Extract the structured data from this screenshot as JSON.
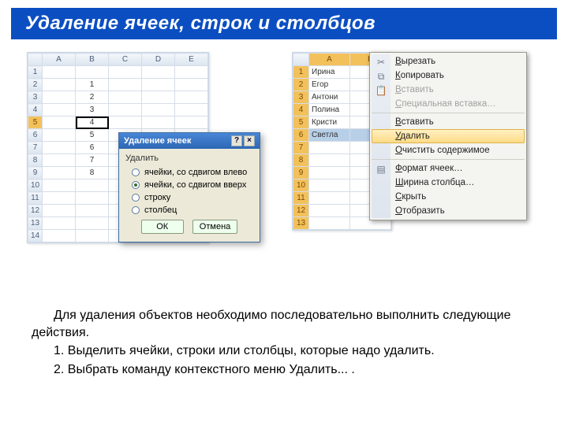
{
  "title": "Удаление ячеек, строк и столбцов",
  "grid1": {
    "cols": [
      "A",
      "B",
      "C",
      "D",
      "E"
    ],
    "rows": [
      1,
      2,
      3,
      4,
      5,
      6,
      7,
      8,
      9,
      10,
      11,
      12,
      13,
      14
    ],
    "bcol": [
      "",
      "1",
      "2",
      "3",
      "4",
      "5",
      "6",
      "7",
      "8",
      "",
      "",
      "",
      "",
      ""
    ],
    "selected_row": 5
  },
  "dialog": {
    "title": "Удаление ячеек",
    "group": "Удалить",
    "opts": [
      "ячейки, со сдвигом влево",
      "ячейки, со сдвигом вверх",
      "строку",
      "столбец"
    ],
    "checked": 1,
    "ok": "ОК",
    "cancel": "Отмена",
    "help": "?",
    "close": "×"
  },
  "grid2": {
    "cols": [
      "A",
      "B"
    ],
    "rows": [
      1,
      2,
      3,
      4,
      5,
      6,
      7,
      8,
      9,
      10,
      11,
      12,
      13
    ],
    "acol": [
      "Ирина",
      "Егор",
      "Антони",
      "Полина",
      "Кристи",
      "Светла",
      "",
      "",
      "",
      "",
      "",
      "",
      ""
    ],
    "selected_row": 6
  },
  "ctx": {
    "items": [
      {
        "label": "Вырезать",
        "icon": "✂"
      },
      {
        "label": "Копировать",
        "icon": "⧉"
      },
      {
        "label": "Вставить",
        "disabled": true,
        "icon": "📋"
      },
      {
        "label": "Специальная вставка…",
        "disabled": true
      },
      {
        "sep": true
      },
      {
        "label": "Вставить"
      },
      {
        "label": "Удалить",
        "hover": true
      },
      {
        "label": "Очистить содержимое"
      },
      {
        "sep": true
      },
      {
        "label": "Формат ячеек…",
        "icon": "▤"
      },
      {
        "label": "Ширина столбца…"
      },
      {
        "label": "Скрыть"
      },
      {
        "label": "Отобразить"
      }
    ]
  },
  "para": {
    "p1": "Для удаления объектов необходимо последовательно выполнить следующие действия.",
    "l1": "1. Выделить ячейки, строки или столбцы, которые надо удалить.",
    "l2": "2. Выбрать команду контекстного меню Удалить... ."
  }
}
